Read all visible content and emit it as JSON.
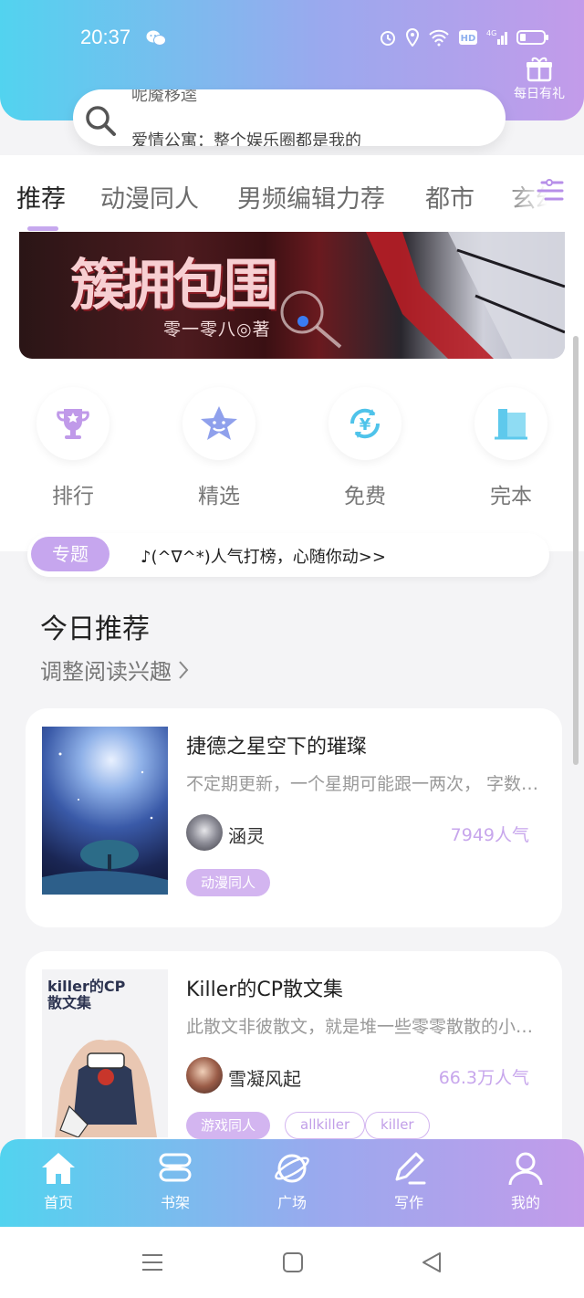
{
  "status_bar": {
    "time": "20:37"
  },
  "header": {
    "gift_label": "每日有礼"
  },
  "search": {
    "line1": "呢魇移逵",
    "line2": "爱情公寓：整个娱乐圈都是我的"
  },
  "tabs": [
    {
      "label": "推荐",
      "active": true
    },
    {
      "label": "动漫同人"
    },
    {
      "label": "男频编辑力荐"
    },
    {
      "label": "都市"
    },
    {
      "label": "玄幻"
    }
  ],
  "banner": {
    "title": "簇拥包围",
    "author": "零一零八◎著"
  },
  "quick_links": [
    {
      "label": "排行",
      "icon": "trophy-icon"
    },
    {
      "label": "精选",
      "icon": "star-icon"
    },
    {
      "label": "免费",
      "icon": "yuan-refresh-icon"
    },
    {
      "label": "完本",
      "icon": "book-icon"
    }
  ],
  "topic": {
    "pill": "专题",
    "text": "♪(^∇^*)人气打榜，心随你动>>"
  },
  "section": {
    "title": "今日推荐",
    "subtitle": "调整阅读兴趣"
  },
  "books": [
    {
      "title": "捷德之星空下的璀璨",
      "desc": "不定期更新，一个星期可能跟一两次， 字数不定",
      "author": "涵灵",
      "popularity": "7949人气",
      "tags": [
        "动漫同人"
      ]
    },
    {
      "title": "Killer的CP散文集",
      "desc": "此散文非彼散文，就是堆一些零零散散的小段子",
      "author": "雪凝风起",
      "popularity": "66.3万人气",
      "tags": [
        "游戏同人",
        "allkiller",
        "killer"
      ],
      "cover_text": "killer的CP散文集"
    }
  ],
  "bottom_nav": [
    {
      "label": "首页",
      "icon": "home-icon",
      "active": true
    },
    {
      "label": "书架",
      "icon": "bookshelf-icon"
    },
    {
      "label": "广场",
      "icon": "planet-icon"
    },
    {
      "label": "写作",
      "icon": "pen-icon"
    },
    {
      "label": "我的",
      "icon": "user-icon"
    }
  ],
  "colors": {
    "accent": "#c6a6ee",
    "gradient_start": "#52d3ef",
    "gradient_end": "#c39bea"
  }
}
